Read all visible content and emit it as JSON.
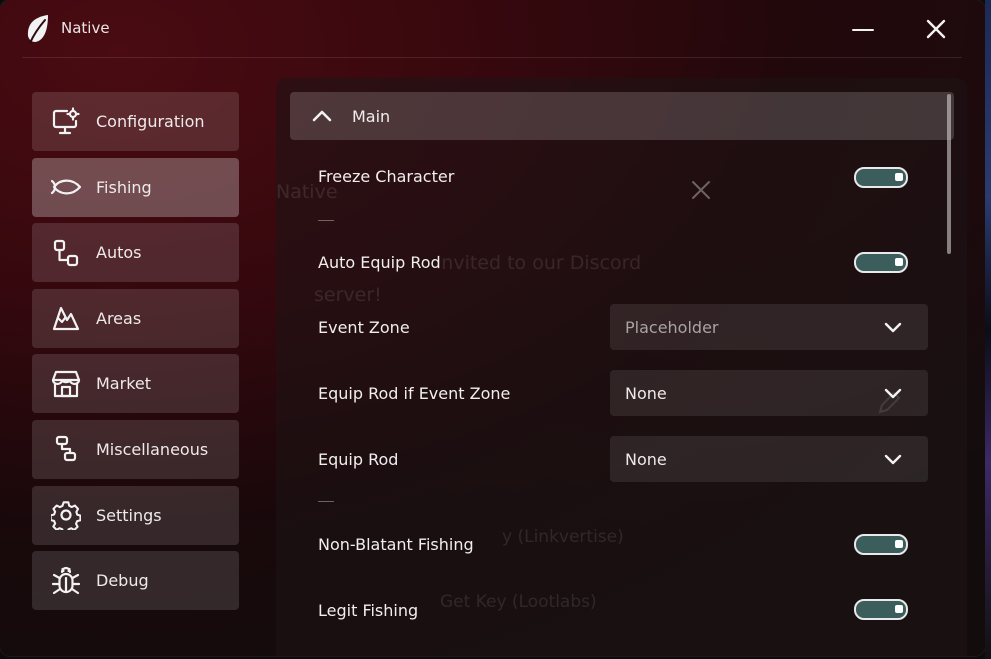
{
  "window": {
    "title": "Native"
  },
  "sidebar": {
    "items": [
      {
        "label": "Configuration",
        "icon": "monitor-gear-icon",
        "active": false
      },
      {
        "label": "Fishing",
        "icon": "fish-icon",
        "active": true
      },
      {
        "label": "Autos",
        "icon": "flow-nodes-icon",
        "active": false
      },
      {
        "label": "Areas",
        "icon": "mountains-icon",
        "active": false
      },
      {
        "label": "Market",
        "icon": "storefront-icon",
        "active": false
      },
      {
        "label": "Miscellaneous",
        "icon": "nodes-icon",
        "active": false
      },
      {
        "label": "Settings",
        "icon": "gear-icon",
        "active": false
      },
      {
        "label": "Debug",
        "icon": "bug-icon",
        "active": false
      }
    ]
  },
  "main": {
    "section_title": "Main",
    "section_expanded": true,
    "toggles": {
      "freeze_character": {
        "label": "Freeze Character",
        "on": true
      },
      "auto_equip_rod": {
        "label": "Auto Equip Rod",
        "on": true
      },
      "non_blatant_fishing": {
        "label": "Non-Blatant Fishing",
        "on": true
      },
      "legit_fishing": {
        "label": "Legit Fishing",
        "on": true
      }
    },
    "dropdowns": {
      "event_zone": {
        "label": "Event Zone",
        "value": "Placeholder"
      },
      "equip_rod_if_event_zone": {
        "label": "Equip Rod if Event Zone",
        "value": "None"
      },
      "equip_rod": {
        "label": "Equip Rod",
        "value": "None"
      }
    }
  },
  "background_ghost": {
    "title": "Native",
    "line1": "invited to our Discord",
    "line2": "server!",
    "line3": "y (Linkvertise)",
    "line4": "Get Key (Lootlabs)"
  },
  "colors": {
    "accent_toggle": "#3b5d5c",
    "window_bg": "#120c0d",
    "brand_red": "#4a0b12"
  }
}
